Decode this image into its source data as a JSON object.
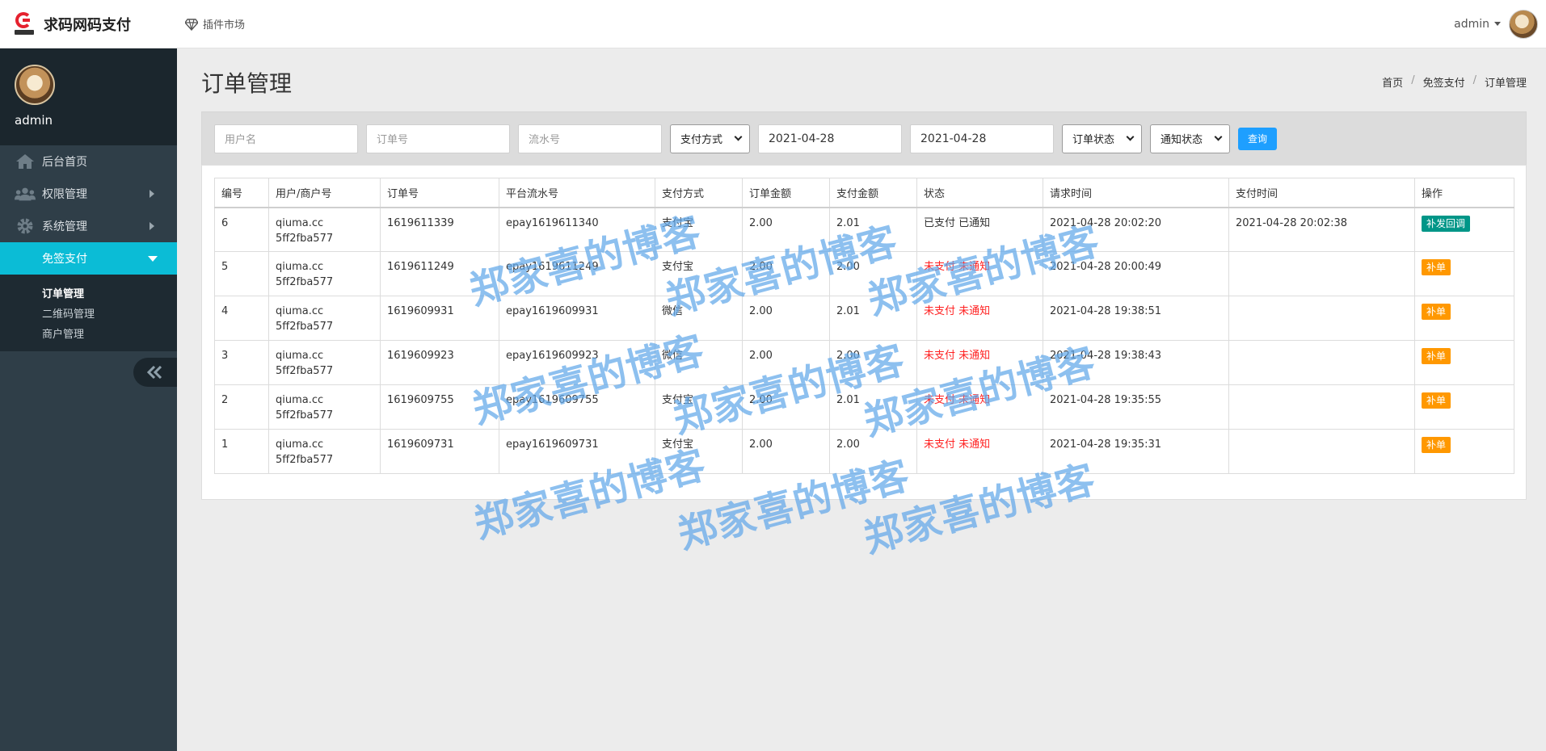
{
  "header": {
    "brand_name": "求码网码支付",
    "plugin_market": "插件市场",
    "user_name": "admin"
  },
  "sidebar": {
    "profile_name": "admin",
    "items": [
      {
        "label": "后台首页",
        "icon": "home-icon"
      },
      {
        "label": "权限管理",
        "icon": "users-icon"
      },
      {
        "label": "系统管理",
        "icon": "gear-icon"
      },
      {
        "label": "免签支付",
        "icon": "none"
      }
    ],
    "subitems": [
      "订单管理",
      "二维码管理",
      "商户管理"
    ],
    "collapse_icon": "double-chevron-left-icon"
  },
  "page": {
    "title": "订单管理",
    "breadcrumb": [
      "首页",
      "免签支付",
      "订单管理"
    ]
  },
  "filters": {
    "username_placeholder": "用户名",
    "order_no_placeholder": "订单号",
    "serial_no_placeholder": "流水号",
    "pay_method": "支付方式",
    "start_date": "2021-04-28",
    "end_date": "2021-04-28",
    "order_status": "订单状态",
    "notify_status": "通知状态",
    "query_button": "查询"
  },
  "table": {
    "columns": [
      "编号",
      "用户/商户号",
      "订单号",
      "平台流水号",
      "支付方式",
      "订单金额",
      "支付金额",
      "状态",
      "请求时间",
      "支付时间",
      "操作"
    ],
    "rows": [
      {
        "id": "6",
        "user": "qiuma.cc",
        "merchant": "5ff2fba577",
        "order": "1619611339",
        "serial": "epay1619611340",
        "method": "支付宝",
        "amount": "2.00",
        "paid": "2.01",
        "pay_status": "已支付",
        "notify_status": "已通知",
        "req_time": "2021-04-28 20:02:20",
        "pay_time": "2021-04-28 20:02:38",
        "action": "补发回调",
        "status_color": "#333333",
        "action_color": "#009688"
      },
      {
        "id": "5",
        "user": "qiuma.cc",
        "merchant": "5ff2fba577",
        "order": "1619611249",
        "serial": "epay1619611249",
        "method": "支付宝",
        "amount": "2.00",
        "paid": "2.00",
        "pay_status": "未支付",
        "notify_status": "未通知",
        "req_time": "2021-04-28 20:00:49",
        "pay_time": "",
        "action": "补单",
        "status_color": "#ff2222",
        "action_color": "#ff9800"
      },
      {
        "id": "4",
        "user": "qiuma.cc",
        "merchant": "5ff2fba577",
        "order": "1619609931",
        "serial": "epay1619609931",
        "method": "微信",
        "amount": "2.00",
        "paid": "2.01",
        "pay_status": "未支付",
        "notify_status": "未通知",
        "req_time": "2021-04-28 19:38:51",
        "pay_time": "",
        "action": "补单",
        "status_color": "#ff2222",
        "action_color": "#ff9800"
      },
      {
        "id": "3",
        "user": "qiuma.cc",
        "merchant": "5ff2fba577",
        "order": "1619609923",
        "serial": "epay1619609923",
        "method": "微信",
        "amount": "2.00",
        "paid": "2.00",
        "pay_status": "未支付",
        "notify_status": "未通知",
        "req_time": "2021-04-28 19:38:43",
        "pay_time": "",
        "action": "补单",
        "status_color": "#ff2222",
        "action_color": "#ff9800"
      },
      {
        "id": "2",
        "user": "qiuma.cc",
        "merchant": "5ff2fba577",
        "order": "1619609755",
        "serial": "epay1619609755",
        "method": "支付宝",
        "amount": "2.00",
        "paid": "2.01",
        "pay_status": "未支付",
        "notify_status": "未通知",
        "req_time": "2021-04-28 19:35:55",
        "pay_time": "",
        "action": "补单",
        "status_color": "#ff2222",
        "action_color": "#ff9800"
      },
      {
        "id": "1",
        "user": "qiuma.cc",
        "merchant": "5ff2fba577",
        "order": "1619609731",
        "serial": "epay1619609731",
        "method": "支付宝",
        "amount": "2.00",
        "paid": "2.00",
        "pay_status": "未支付",
        "notify_status": "未通知",
        "req_time": "2021-04-28 19:35:31",
        "pay_time": "",
        "action": "补单",
        "status_color": "#ff2222",
        "action_color": "#ff9800"
      }
    ]
  },
  "watermark": {
    "text": "郑家喜的博客",
    "color": "#62a8ea"
  }
}
